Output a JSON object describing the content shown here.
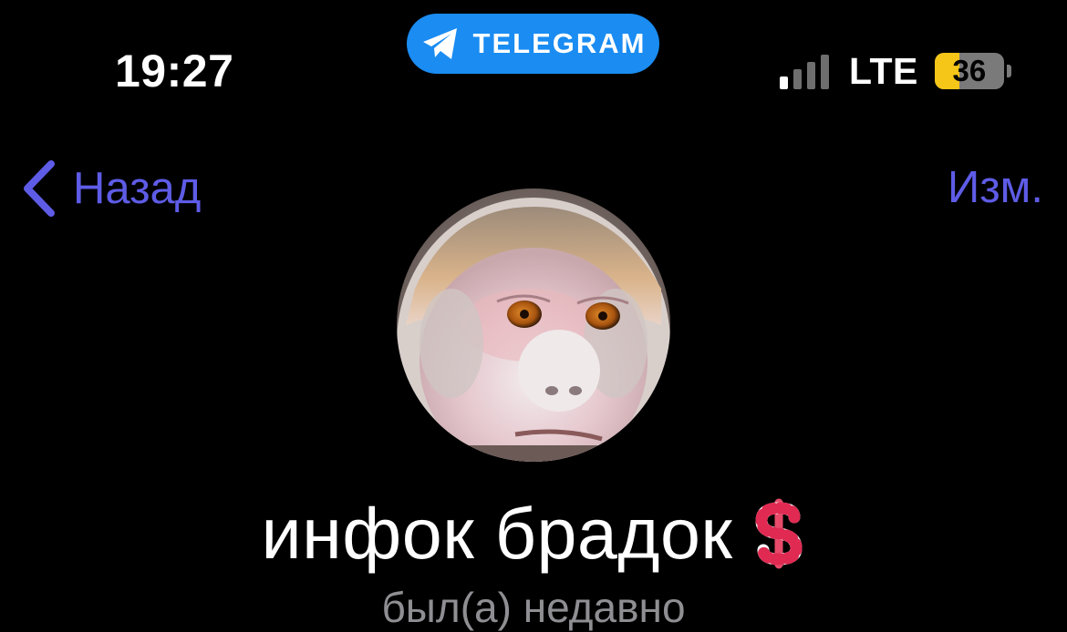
{
  "status_bar": {
    "time": "19:27",
    "app_pill_label": "TELEGRAM",
    "network": "LTE",
    "battery_level": "36",
    "battery_fraction": 0.36,
    "signal_bars_active": 1,
    "signal_bars_total": 4,
    "colors": {
      "app_pill": "#1a8cf2",
      "battery_fill": "#f5c518"
    }
  },
  "nav": {
    "back_label": "Назад",
    "edit_label": "Изм.",
    "accent_color": "#5e5ce6"
  },
  "profile": {
    "name": "инфок брадок",
    "emoji_badge": "dollar-sign-icon",
    "last_seen": "был(а) недавно"
  }
}
